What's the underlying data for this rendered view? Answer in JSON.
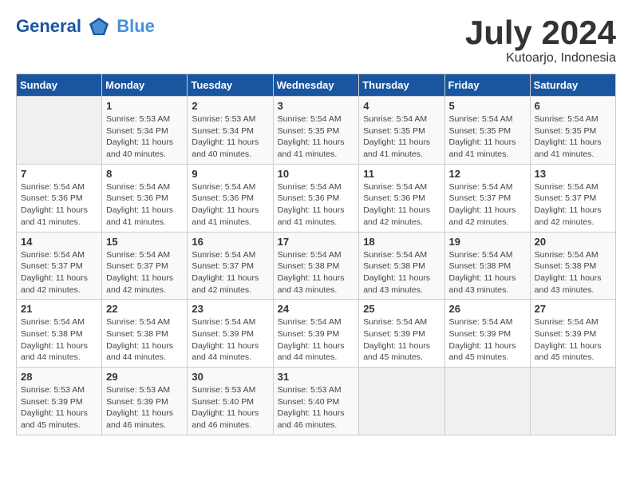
{
  "header": {
    "logo_general": "General",
    "logo_blue": "Blue",
    "month_title": "July 2024",
    "subtitle": "Kutoarjo, Indonesia"
  },
  "days_of_week": [
    "Sunday",
    "Monday",
    "Tuesday",
    "Wednesday",
    "Thursday",
    "Friday",
    "Saturday"
  ],
  "weeks": [
    [
      {
        "day": "",
        "info": ""
      },
      {
        "day": "1",
        "info": "Sunrise: 5:53 AM\nSunset: 5:34 PM\nDaylight: 11 hours\nand 40 minutes."
      },
      {
        "day": "2",
        "info": "Sunrise: 5:53 AM\nSunset: 5:34 PM\nDaylight: 11 hours\nand 40 minutes."
      },
      {
        "day": "3",
        "info": "Sunrise: 5:54 AM\nSunset: 5:35 PM\nDaylight: 11 hours\nand 41 minutes."
      },
      {
        "day": "4",
        "info": "Sunrise: 5:54 AM\nSunset: 5:35 PM\nDaylight: 11 hours\nand 41 minutes."
      },
      {
        "day": "5",
        "info": "Sunrise: 5:54 AM\nSunset: 5:35 PM\nDaylight: 11 hours\nand 41 minutes."
      },
      {
        "day": "6",
        "info": "Sunrise: 5:54 AM\nSunset: 5:35 PM\nDaylight: 11 hours\nand 41 minutes."
      }
    ],
    [
      {
        "day": "7",
        "info": "Sunrise: 5:54 AM\nSunset: 5:36 PM\nDaylight: 11 hours\nand 41 minutes."
      },
      {
        "day": "8",
        "info": "Sunrise: 5:54 AM\nSunset: 5:36 PM\nDaylight: 11 hours\nand 41 minutes."
      },
      {
        "day": "9",
        "info": "Sunrise: 5:54 AM\nSunset: 5:36 PM\nDaylight: 11 hours\nand 41 minutes."
      },
      {
        "day": "10",
        "info": "Sunrise: 5:54 AM\nSunset: 5:36 PM\nDaylight: 11 hours\nand 41 minutes."
      },
      {
        "day": "11",
        "info": "Sunrise: 5:54 AM\nSunset: 5:36 PM\nDaylight: 11 hours\nand 42 minutes."
      },
      {
        "day": "12",
        "info": "Sunrise: 5:54 AM\nSunset: 5:37 PM\nDaylight: 11 hours\nand 42 minutes."
      },
      {
        "day": "13",
        "info": "Sunrise: 5:54 AM\nSunset: 5:37 PM\nDaylight: 11 hours\nand 42 minutes."
      }
    ],
    [
      {
        "day": "14",
        "info": "Sunrise: 5:54 AM\nSunset: 5:37 PM\nDaylight: 11 hours\nand 42 minutes."
      },
      {
        "day": "15",
        "info": "Sunrise: 5:54 AM\nSunset: 5:37 PM\nDaylight: 11 hours\nand 42 minutes."
      },
      {
        "day": "16",
        "info": "Sunrise: 5:54 AM\nSunset: 5:37 PM\nDaylight: 11 hours\nand 42 minutes."
      },
      {
        "day": "17",
        "info": "Sunrise: 5:54 AM\nSunset: 5:38 PM\nDaylight: 11 hours\nand 43 minutes."
      },
      {
        "day": "18",
        "info": "Sunrise: 5:54 AM\nSunset: 5:38 PM\nDaylight: 11 hours\nand 43 minutes."
      },
      {
        "day": "19",
        "info": "Sunrise: 5:54 AM\nSunset: 5:38 PM\nDaylight: 11 hours\nand 43 minutes."
      },
      {
        "day": "20",
        "info": "Sunrise: 5:54 AM\nSunset: 5:38 PM\nDaylight: 11 hours\nand 43 minutes."
      }
    ],
    [
      {
        "day": "21",
        "info": "Sunrise: 5:54 AM\nSunset: 5:38 PM\nDaylight: 11 hours\nand 44 minutes."
      },
      {
        "day": "22",
        "info": "Sunrise: 5:54 AM\nSunset: 5:38 PM\nDaylight: 11 hours\nand 44 minutes."
      },
      {
        "day": "23",
        "info": "Sunrise: 5:54 AM\nSunset: 5:39 PM\nDaylight: 11 hours\nand 44 minutes."
      },
      {
        "day": "24",
        "info": "Sunrise: 5:54 AM\nSunset: 5:39 PM\nDaylight: 11 hours\nand 44 minutes."
      },
      {
        "day": "25",
        "info": "Sunrise: 5:54 AM\nSunset: 5:39 PM\nDaylight: 11 hours\nand 45 minutes."
      },
      {
        "day": "26",
        "info": "Sunrise: 5:54 AM\nSunset: 5:39 PM\nDaylight: 11 hours\nand 45 minutes."
      },
      {
        "day": "27",
        "info": "Sunrise: 5:54 AM\nSunset: 5:39 PM\nDaylight: 11 hours\nand 45 minutes."
      }
    ],
    [
      {
        "day": "28",
        "info": "Sunrise: 5:53 AM\nSunset: 5:39 PM\nDaylight: 11 hours\nand 45 minutes."
      },
      {
        "day": "29",
        "info": "Sunrise: 5:53 AM\nSunset: 5:39 PM\nDaylight: 11 hours\nand 46 minutes."
      },
      {
        "day": "30",
        "info": "Sunrise: 5:53 AM\nSunset: 5:40 PM\nDaylight: 11 hours\nand 46 minutes."
      },
      {
        "day": "31",
        "info": "Sunrise: 5:53 AM\nSunset: 5:40 PM\nDaylight: 11 hours\nand 46 minutes."
      },
      {
        "day": "",
        "info": ""
      },
      {
        "day": "",
        "info": ""
      },
      {
        "day": "",
        "info": ""
      }
    ]
  ]
}
